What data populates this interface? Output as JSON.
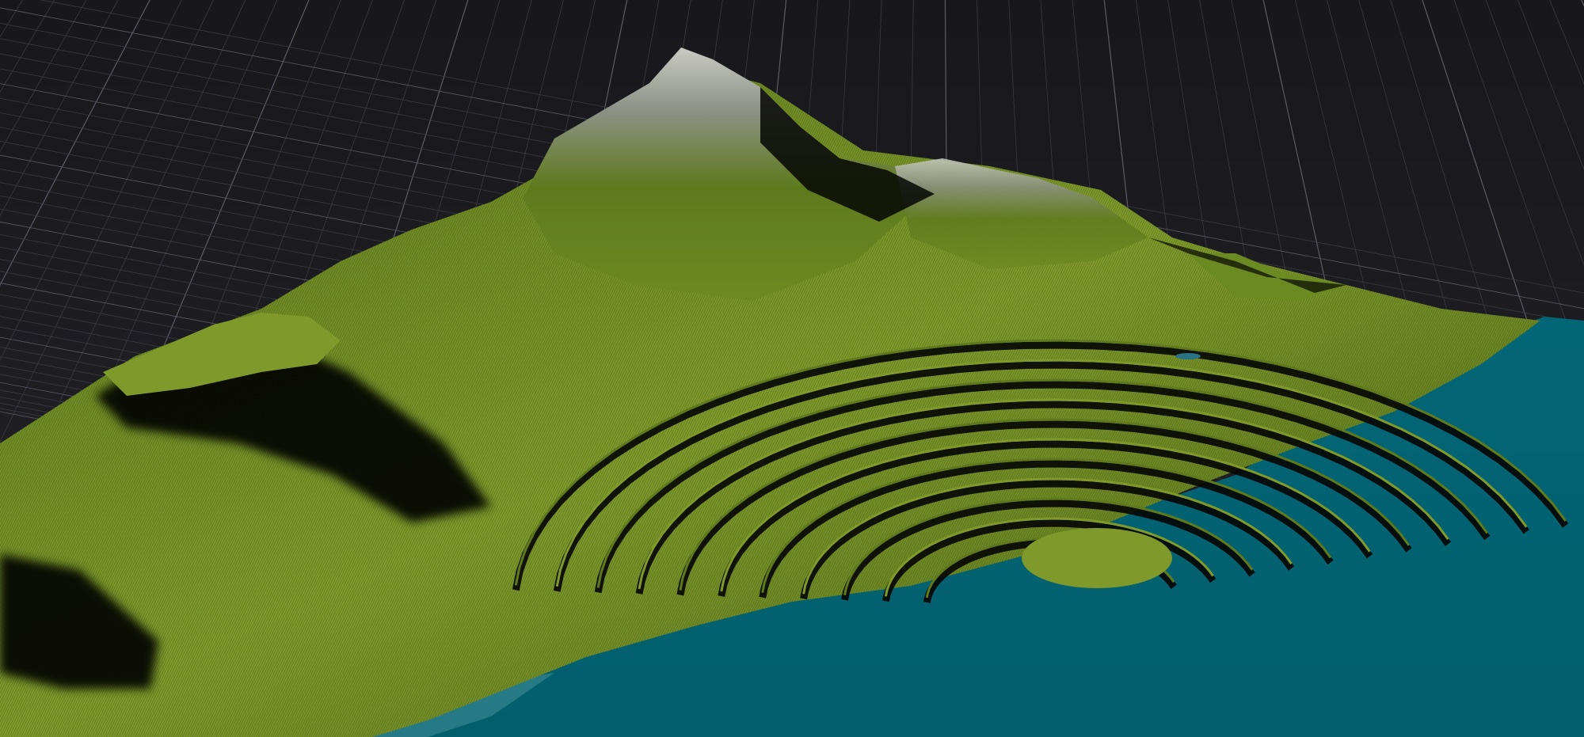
{
  "viewport": {
    "background": "#1c1c20",
    "grid_color": "#5b5b66",
    "grid_minor_color": "#3a3a42"
  },
  "terrain": {
    "colors": {
      "grass_light": "#7f9a2b",
      "grass_mid": "#5e7a1d",
      "grass_dark": "#3f5612",
      "rock": "#8d9185",
      "rock_light": "#c9cbc2",
      "shadow": "#050604",
      "path": "#5d5a4e"
    }
  },
  "water": {
    "color": "#036676",
    "shallow_color": "#3d8e97"
  }
}
